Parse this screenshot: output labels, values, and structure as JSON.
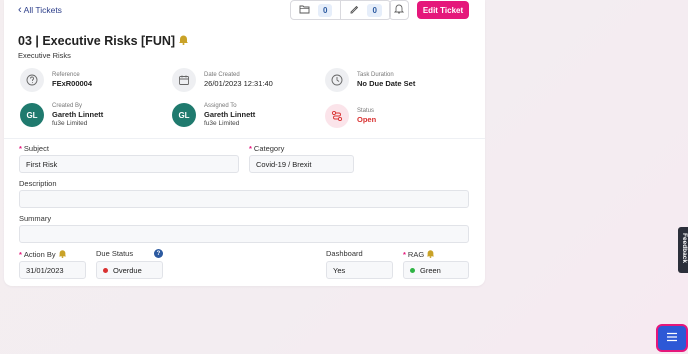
{
  "nav": {
    "back_label": "All Tickets"
  },
  "toolbar": {
    "attachments_count": "0",
    "notes_count": "0",
    "edit_label": "Edit Ticket"
  },
  "ticket": {
    "title": "03 | Executive Risks [FUN]",
    "subtitle": "Executive Risks"
  },
  "info": {
    "reference_label": "Reference",
    "reference_value": "FExR00004",
    "date_created_label": "Date Created",
    "date_created_value": "26/01/2023 12:31:40",
    "task_duration_label": "Task Duration",
    "task_duration_value": "No Due Date Set",
    "created_by_label": "Created By",
    "created_by_initials": "GL",
    "created_by_name": "Gareth Linnett",
    "created_by_org": "fu3e Limited",
    "assigned_to_label": "Assigned To",
    "assigned_to_initials": "GL",
    "assigned_to_name": "Gareth Linnett",
    "assigned_to_org": "fu3e Limited",
    "status_label": "Status",
    "status_value": "Open"
  },
  "form": {
    "subject_label": "Subject",
    "subject_value": "First Risk",
    "category_label": "Category",
    "category_value": "Covid-19 / Brexit",
    "description_label": "Description",
    "description_value": "",
    "summary_label": "Summary",
    "summary_value": "",
    "action_by_label": "Action By",
    "action_by_value": "31/01/2023",
    "due_status_label": "Due Status",
    "due_status_value": "Overdue",
    "due_status_color": "#d93030",
    "dashboard_label": "Dashboard",
    "dashboard_value": "Yes",
    "rag_label": "RAG",
    "rag_value": "Green",
    "rag_color": "#2fb344",
    "required_mark": "*",
    "help_mark": "?"
  },
  "feedback": {
    "label": "Feedback"
  },
  "icons": {
    "back": "chevron-left-icon",
    "attachments": "folder-icon",
    "notes": "pencil-icon",
    "notifications": "bell-icon",
    "title_alert": "bell-alert-icon",
    "reference": "question-circle-icon",
    "date": "calendar-icon",
    "duration": "clock-icon",
    "status": "status-icon",
    "menu": "hamburger-menu-icon"
  },
  "colors": {
    "accent": "#e5177b",
    "link": "#2c3e8a",
    "avatar": "#1f7a6e",
    "status_open": "#d93030",
    "menu_button": "#2d58d6"
  }
}
